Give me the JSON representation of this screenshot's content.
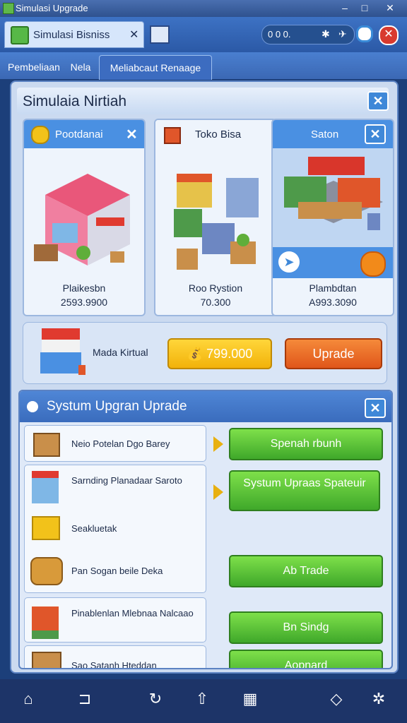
{
  "window": {
    "title": "Simulasi Upgrade"
  },
  "toolbar": {
    "doc_tab_label": "Simulasi Bisniss",
    "status_text": "0 0 0.",
    "icons": [
      "close-icon",
      "image-icon",
      "gear-icon",
      "airplane-icon",
      "edge-icon",
      "close-circle-icon"
    ]
  },
  "nav_tabs": [
    "Pembeliaan",
    "Nela",
    "Meliabcaut Renaage"
  ],
  "panel": {
    "title": "Simulaia Nirtiah",
    "cards": [
      {
        "label": "Pootdanai",
        "name": "Plaikesbn",
        "value": "2593.9900"
      },
      {
        "label": "Toko Bisa",
        "name": "Roo Rystion",
        "value": "70.300"
      },
      {
        "label": "Saton",
        "name": "Plambdtan",
        "value": "A993.3090"
      }
    ],
    "banner": {
      "label": "Mada Kirtual",
      "price_button": "799.000",
      "upgrade_button": "Uprade"
    }
  },
  "upgrade_panel": {
    "title": "Systum Upgran Uprade",
    "items": [
      {
        "text": "Neio Potelan Dgo Barey"
      },
      {
        "text": "Sarnding Planadaar Saroto"
      },
      {
        "text": "Seakluetak"
      },
      {
        "text": "Pan Sogan beile Deka"
      },
      {
        "text": "Pinablenlan Mlebnaa Nalcaao"
      },
      {
        "text": "Sao Satanh Hteddan"
      }
    ],
    "buttons": [
      "Spenah rbunh",
      "Systum Upraas Spateuir",
      "Ab Trade",
      "Bn Sindg",
      "Aopnard"
    ]
  },
  "colors": {
    "accent": "#3f88d8",
    "green": "#3fa82a",
    "orange": "#e56a1e",
    "gold": "#f2c21a"
  }
}
